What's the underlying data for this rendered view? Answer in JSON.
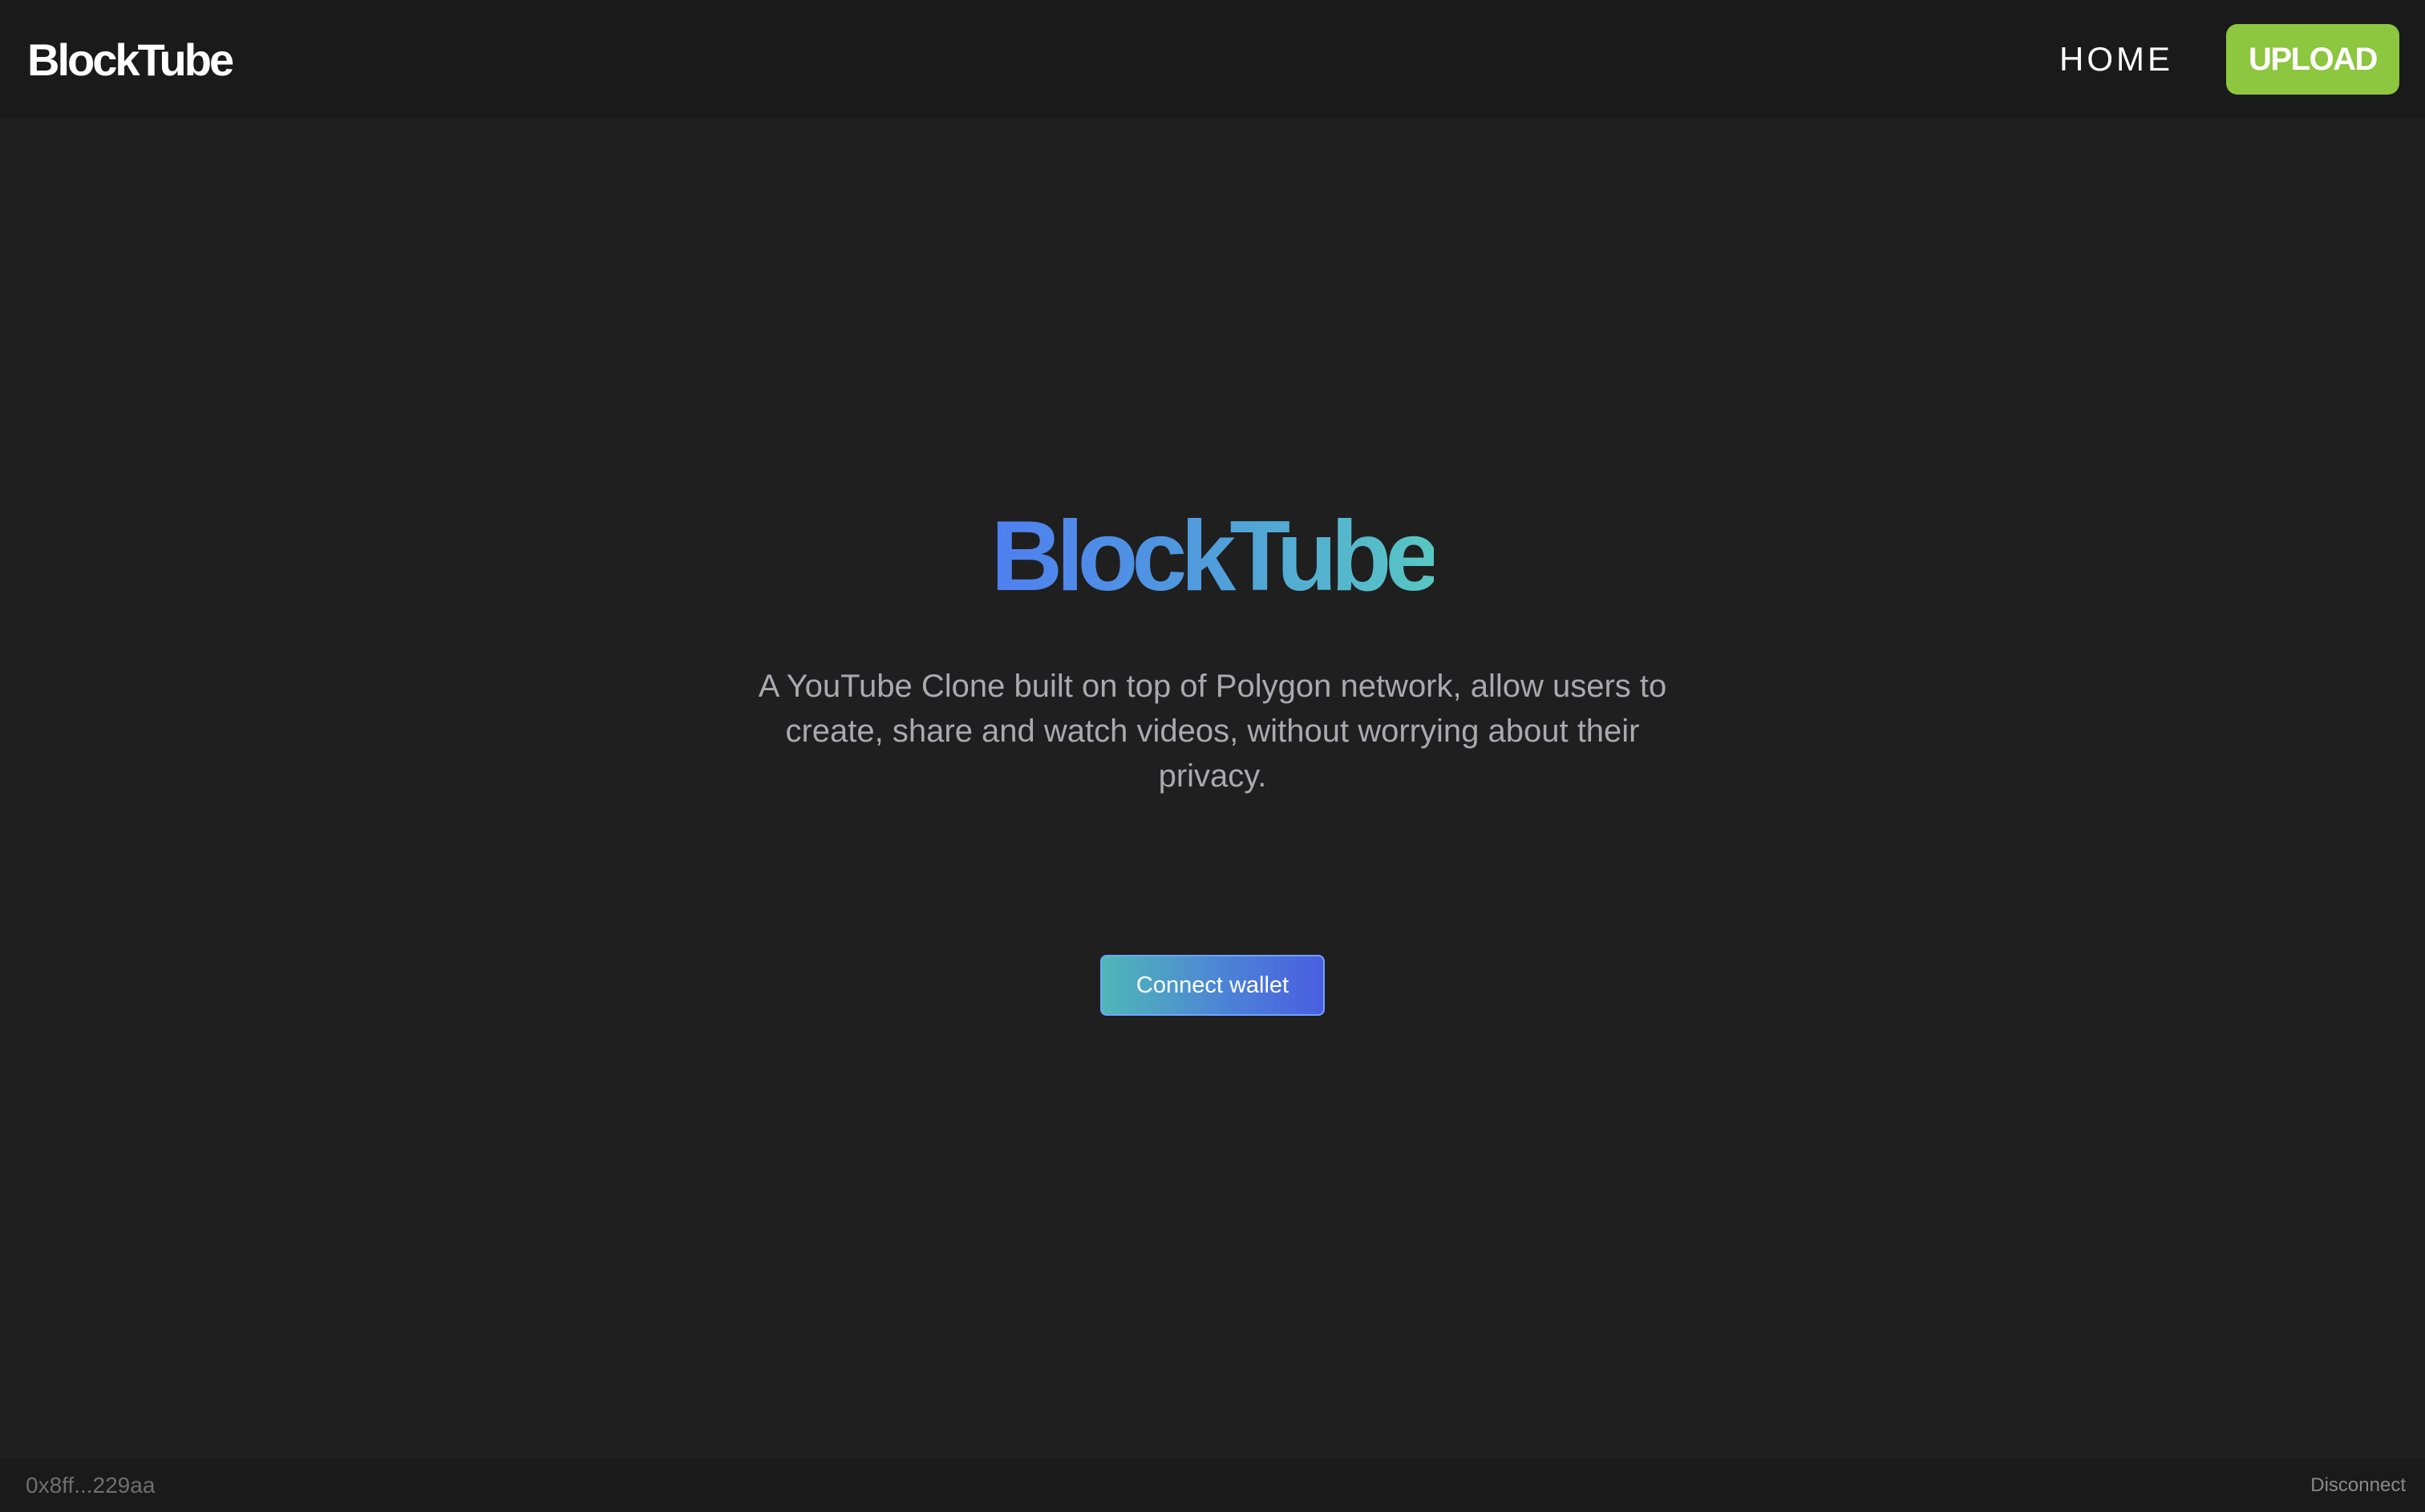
{
  "header": {
    "brand": "BlockTube",
    "nav_home": "HOME",
    "upload_label": "UPLOAD"
  },
  "hero": {
    "title": "BlockTube",
    "description": "A YouTube Clone built on top of Polygon network, allow users to create, share and watch videos, without worrying about their privacy.",
    "connect_label": "Connect wallet"
  },
  "footer": {
    "wallet_address": "0x8ff...229aa",
    "disconnect_label": "Disconnect"
  },
  "colors": {
    "background": "#1f1f1f",
    "bar_background": "#1a1a1a",
    "upload_green": "#8dc63f",
    "title_gradient_start": "#4f7ff0",
    "title_gradient_end": "#58c7c2",
    "description_text": "#a9a9ae"
  }
}
